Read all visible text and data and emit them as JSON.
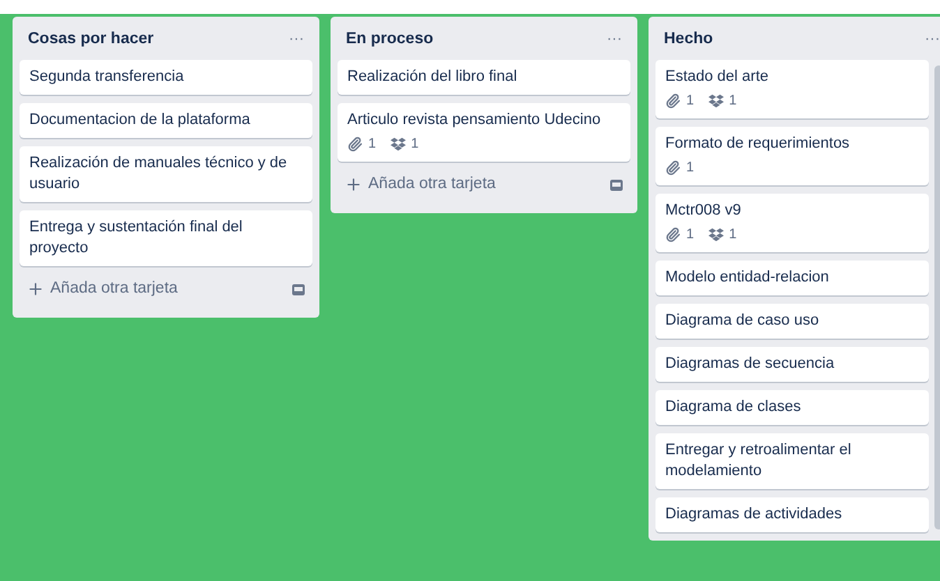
{
  "lists": [
    {
      "title": "Cosas por hacer",
      "menu": "···",
      "add_card": "Añada otra tarjeta",
      "cards": [
        {
          "title": "Segunda transferencia"
        },
        {
          "title": "Documentacion de la plataforma"
        },
        {
          "title": "Realización de manuales técnico y de usuario"
        },
        {
          "title": "Entrega y sustentación final del proyecto"
        }
      ]
    },
    {
      "title": "En proceso",
      "menu": "···",
      "add_card": "Añada otra tarjeta",
      "cards": [
        {
          "title": "Realización del libro final"
        },
        {
          "title": "Articulo revista pensamiento Udecino",
          "badges": [
            {
              "kind": "attachment",
              "count": "1"
            },
            {
              "kind": "dropbox",
              "count": "1"
            }
          ]
        }
      ]
    },
    {
      "title": "Hecho",
      "menu": "···",
      "cards": [
        {
          "title": "Estado del arte",
          "badges": [
            {
              "kind": "attachment",
              "count": "1"
            },
            {
              "kind": "dropbox",
              "count": "1"
            }
          ]
        },
        {
          "title": "Formato de requerimientos",
          "badges": [
            {
              "kind": "attachment",
              "count": "1"
            }
          ]
        },
        {
          "title": "Mctr008 v9",
          "badges": [
            {
              "kind": "attachment",
              "count": "1"
            },
            {
              "kind": "dropbox",
              "count": "1"
            }
          ]
        },
        {
          "title": "Modelo entidad-relacion"
        },
        {
          "title": "Diagrama de caso uso"
        },
        {
          "title": "Diagramas de secuencia"
        },
        {
          "title": "Diagrama de clases"
        },
        {
          "title": "Entregar y retroalimentar el modelamiento"
        },
        {
          "title": "Diagramas de actividades"
        }
      ]
    }
  ]
}
